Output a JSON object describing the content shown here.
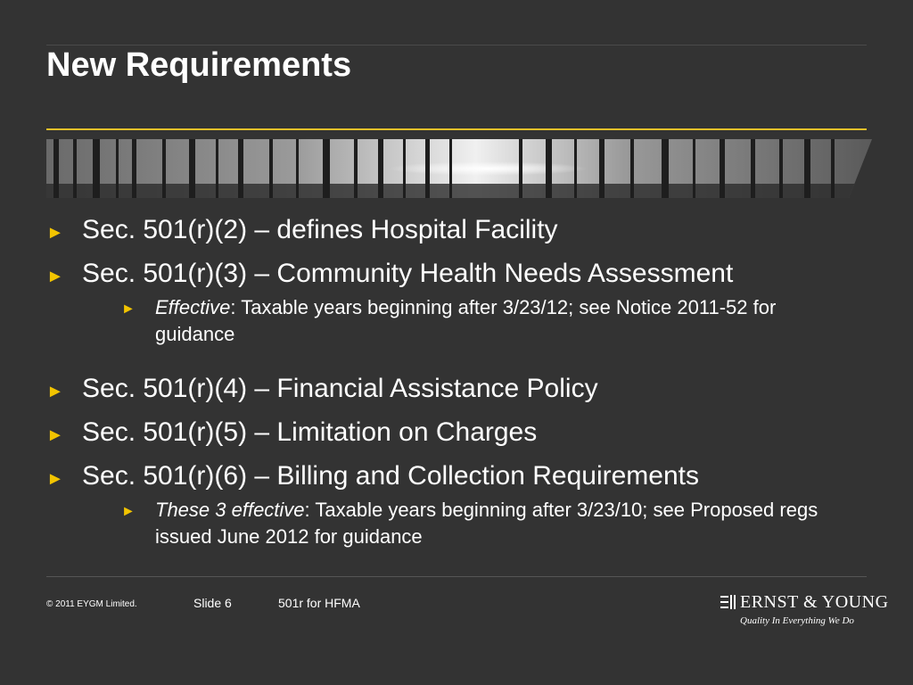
{
  "slide": {
    "title": "New Requirements"
  },
  "bullets": [
    {
      "text": "Sec. 501(r)(2) – defines Hospital Facility"
    },
    {
      "text": "Sec. 501(r)(3) – Community Health Needs Assessment",
      "sub": {
        "emphasis": "Effective",
        "text": ": Taxable years beginning after 3/23/12; see Notice 2011-52 for guidance"
      }
    },
    {
      "text": "Sec. 501(r)(4) – Financial Assistance Policy"
    },
    {
      "text": "Sec. 501(r)(5) – Limitation on Charges"
    },
    {
      "text": "Sec. 501(r)(6) – Billing and Collection Requirements",
      "sub": {
        "emphasis": "These 3 effective",
        "text": ": Taxable years beginning after 3/23/10; see Proposed regs issued June 2012 for guidance"
      }
    }
  ],
  "bullet_glyph": "►",
  "footer": {
    "copyright": "© 2011 EYGM Limited.",
    "slide_number": "Slide 6",
    "presentation_title": "501r for HFMA"
  },
  "logo": {
    "name": "ERNST & YOUNG",
    "tagline": "Quality In Everything We Do"
  },
  "colors": {
    "background": "#333333",
    "accent": "#e8c02a",
    "bullet": "#f2c400",
    "text": "#ffffff"
  },
  "icons": {
    "bullet": "triangle-right-icon",
    "logo": "ernst-young-logo-icon"
  }
}
